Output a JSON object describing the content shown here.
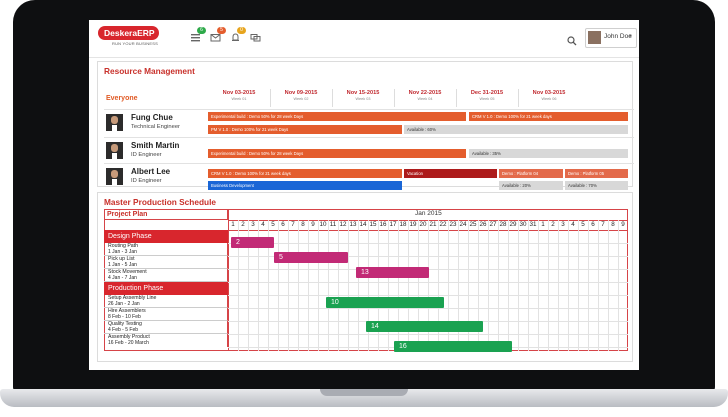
{
  "app": {
    "logo_text": "DeskeraERP",
    "logo_tagline": "RUN YOUR BUSINESS",
    "badges": [
      "6",
      "5",
      "0"
    ],
    "user_name": "John Doe",
    "colors": {
      "brand": "#d8262d",
      "orange": "#e45d2d",
      "magenta": "#c22a76",
      "green": "#1aa251",
      "blue": "#1a66d6"
    }
  },
  "resource": {
    "title": "Resource Management",
    "group": "Everyone",
    "weeks": [
      {
        "date": "Nov 03-2015",
        "week": "Week 01"
      },
      {
        "date": "Nov 09-2015",
        "week": "Week 02"
      },
      {
        "date": "Nov 15-2015",
        "week": "Week 03"
      },
      {
        "date": "Nov 22-2015",
        "week": "Week 04"
      },
      {
        "date": "Dec 31-2015",
        "week": "Week 05"
      },
      {
        "date": "Nov 03-2015",
        "week": "Week 06"
      }
    ],
    "people": [
      {
        "name": "Fung Chue",
        "role": "Technical Engineer"
      },
      {
        "name": "Smith Martin",
        "role": "ID Engineer"
      },
      {
        "name": "Albert Lee",
        "role": "ID Engineer"
      }
    ],
    "bars": [
      "Experimental build : Demo 50% for 28 week Days",
      "CRM V 1.0 : Demo 100% for 21 week days",
      "PM V 1.0 : Demo 100% for 21 week Days",
      "Available : 60%",
      "Experimental build : Demo 50% for 28 week Days",
      "Available : 35%",
      "CRM V 1.0 : Demo 100% for 21 week days",
      "Vacation",
      "Demo : Platform 04",
      "Demo : Platform 05",
      "Business Development",
      "Available : 20%",
      "Available : 70%"
    ]
  },
  "production": {
    "title": "Master Production Schedule",
    "project_plan": "Project Plan",
    "month": "Jan 2015",
    "days": [
      "1",
      "2",
      "3",
      "4",
      "5",
      "6",
      "7",
      "8",
      "9",
      "10",
      "11",
      "12",
      "13",
      "14",
      "15",
      "16",
      "17",
      "18",
      "19",
      "20",
      "21",
      "22",
      "23",
      "24",
      "25",
      "26",
      "27",
      "28",
      "29",
      "30",
      "31",
      "1",
      "2",
      "3",
      "4",
      "5",
      "6",
      "7",
      "8",
      "9"
    ],
    "phases": [
      "Design Phase",
      "Production Phase"
    ],
    "tasks": [
      {
        "name": "Routing Path",
        "dates": "1 Jan - 3 Jan"
      },
      {
        "name": "Pick up List",
        "dates": "1 Jan - 5 Jan"
      },
      {
        "name": "Stock Movement",
        "dates": "4 Jan - 7 Jan"
      },
      {
        "name": "Setup Assembly Line",
        "dates": "26 Jan - 2 Jan"
      },
      {
        "name": "Hire Assemblers",
        "dates": "8 Feb - 10 Feb"
      },
      {
        "name": "Quality Testing",
        "dates": "4 Feb - 5 Feb"
      },
      {
        "name": "Assembly Product",
        "dates": "16 Feb - 20 March"
      }
    ],
    "bar_labels": [
      "2",
      "5",
      "13",
      "10",
      "14",
      "16"
    ]
  }
}
